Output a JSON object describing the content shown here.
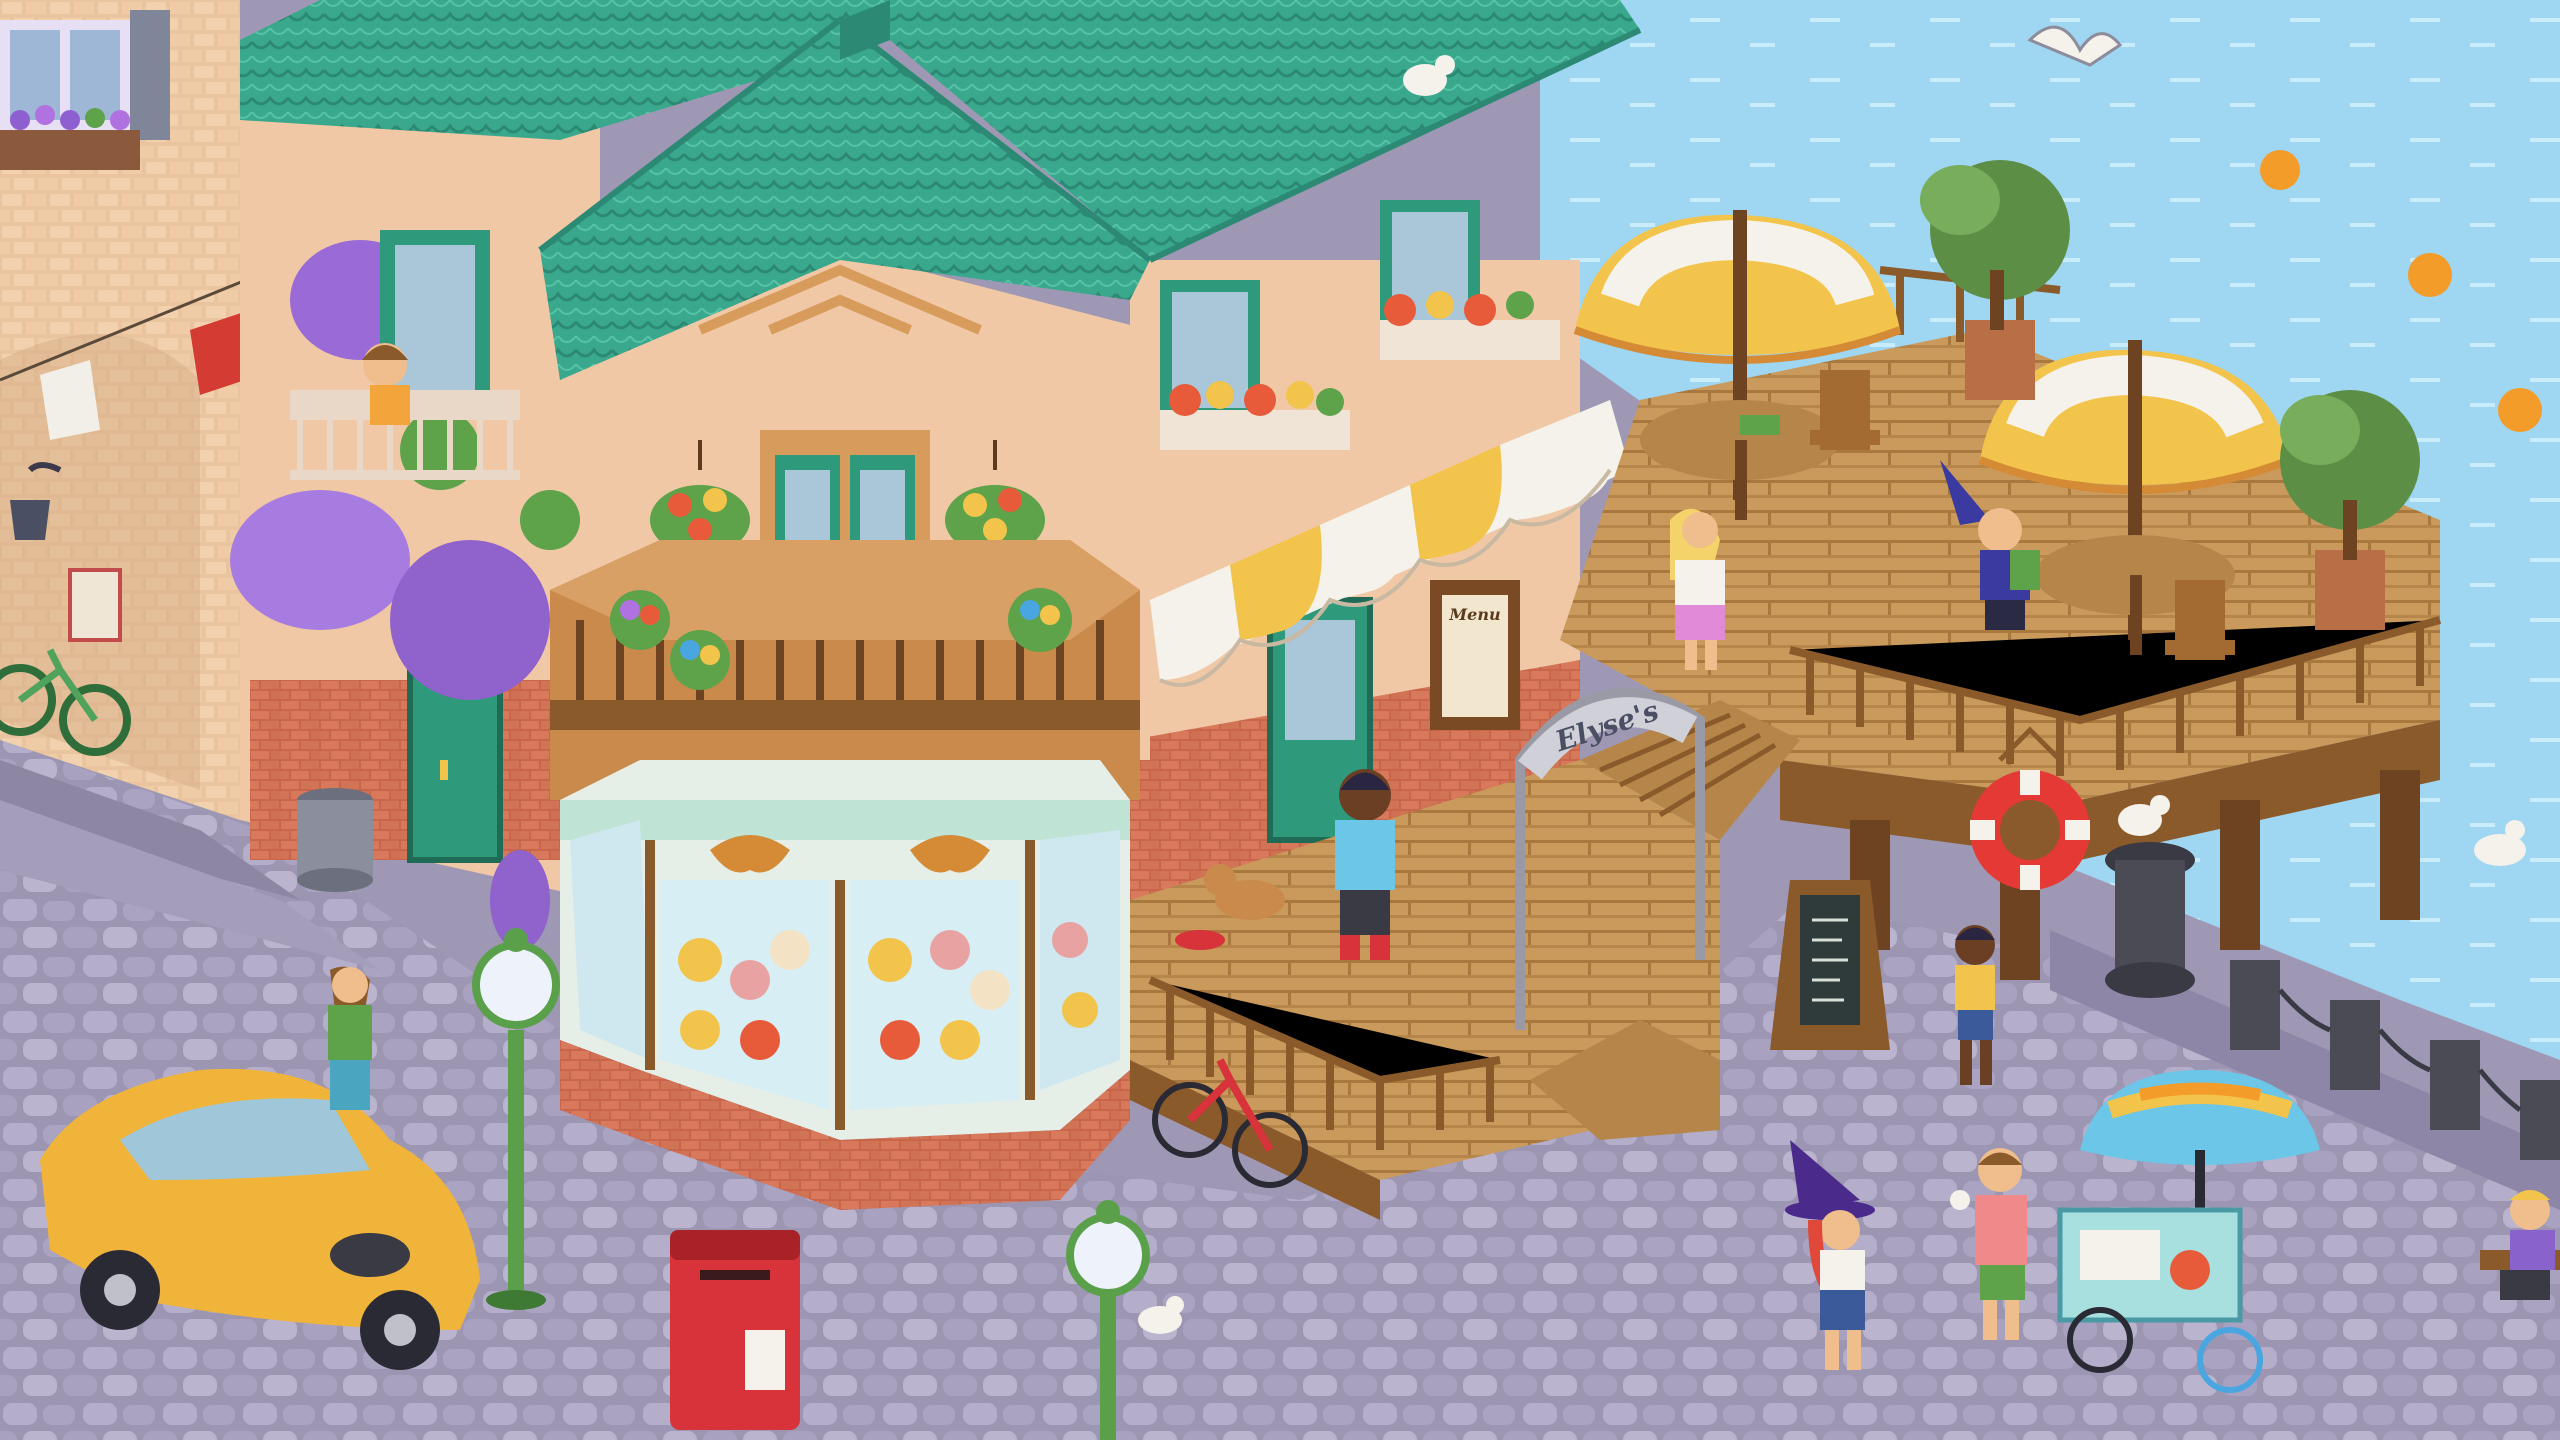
{
  "scene": {
    "arch_sign": "Elyse's",
    "menu_sign": "Menu",
    "colors": {
      "sea": "#9fd6f2",
      "roof": "#3fae93",
      "wall": "#f1c8a6",
      "deck": "#c99a5c",
      "cobble": "#a9a3c0",
      "awning_yellow": "#f3c44b",
      "awning_white": "#f4f2ea",
      "car": "#f0b43a",
      "mailbox": "#d8323a"
    },
    "icons": [
      "seagull-icon",
      "umbrella-icon",
      "lifebuoy-icon",
      "croissant-icon",
      "bicycle-icon",
      "lamp-post-icon",
      "mailbox-icon",
      "ice-cream-cart-icon",
      "car-icon",
      "buoy-icon"
    ]
  }
}
